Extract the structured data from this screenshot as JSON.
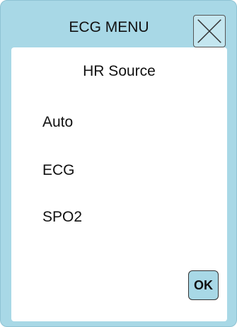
{
  "dialog": {
    "title": "ECG MENU",
    "close_icon": "close-icon",
    "section_label": "HR Source",
    "options": [
      {
        "label": "Auto"
      },
      {
        "label": "ECG"
      },
      {
        "label": "SPO2"
      }
    ],
    "ok_label": "OK"
  },
  "colors": {
    "frame": "#a8d8e6",
    "panel": "#ffffff",
    "text": "#111111"
  }
}
